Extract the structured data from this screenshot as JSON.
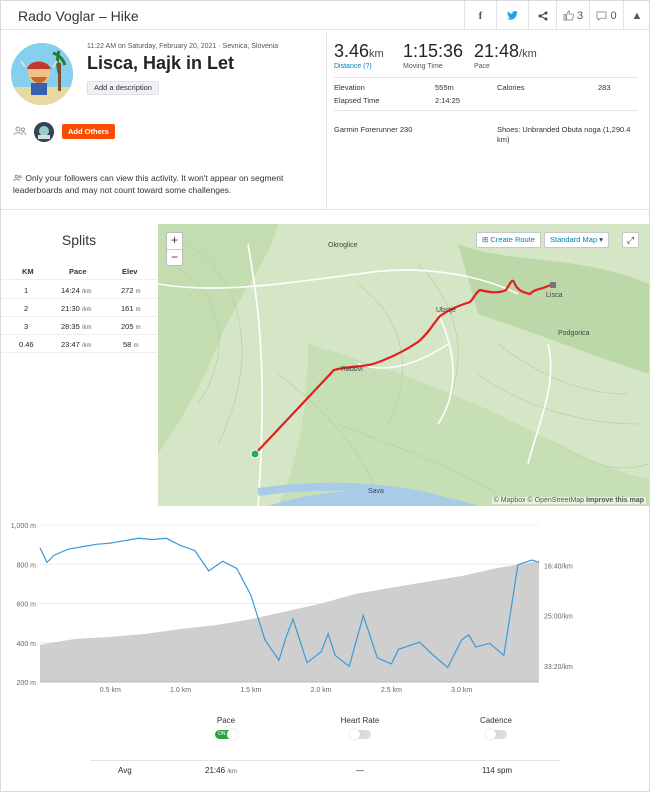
{
  "header": {
    "title": "Rado Voglar – Hike",
    "kudos_count": "3",
    "comment_count": "0"
  },
  "activity": {
    "meta": "11:22 AM on Saturday, February 20, 2021 · Sevnica, Slovenia",
    "name": "Lisca, Hajk in Let",
    "add_description": "Add a description",
    "add_others": "Add Others",
    "privacy": "Only your followers can view this activity. It won't appear on segment leaderboards and may not count toward some challenges."
  },
  "stats": {
    "distance": {
      "value": "3.46",
      "unit": "km",
      "label": "Distance (?)"
    },
    "moving_time": {
      "value": "1:15:36",
      "label": "Moving Time"
    },
    "pace": {
      "value": "21:48",
      "unit": "/km",
      "label": "Pace"
    },
    "elevation_label": "Elevation",
    "elevation_value": "555m",
    "calories_label": "Calories",
    "calories_value": "283",
    "elapsed_label": "Elapsed Time",
    "elapsed_value": "2:14:25",
    "device": "Garmin Forerunner 230",
    "shoes": "Shoes: Unbranded Obuta noga (1,290.4 km)"
  },
  "splits": {
    "title": "Splits",
    "headers": [
      "KM",
      "Pace",
      "Elev"
    ],
    "rows": [
      {
        "km": "1",
        "pace": "14:24",
        "pace_unit": "/km",
        "elev": "272",
        "elev_unit": "m"
      },
      {
        "km": "2",
        "pace": "21:30",
        "pace_unit": "/km",
        "elev": "161",
        "elev_unit": "m"
      },
      {
        "km": "3",
        "pace": "28:35",
        "pace_unit": "/km",
        "elev": "205",
        "elev_unit": "m"
      },
      {
        "km": "0.46",
        "pace": "23:47",
        "pace_unit": "/km",
        "elev": "58",
        "elev_unit": "m"
      }
    ]
  },
  "map": {
    "zoom_in": "+",
    "zoom_out": "−",
    "create_route": "Create Route",
    "standard_map": "Standard Map",
    "attribution": "© Mapbox © OpenStreetMap",
    "improve": "Improve this map",
    "labels": [
      "Okroglice",
      "Lisca",
      "Podgorica",
      "Ubstje",
      "Radovi",
      "Sava"
    ],
    "route_color": "#e02020"
  },
  "chart_data": {
    "type": "line",
    "x_ticks": [
      "0.5 km",
      "1.0 km",
      "1.5 km",
      "2.0 km",
      "2.5 km",
      "3.0 km"
    ],
    "y_left_ticks": [
      "1,000 m",
      "800 m",
      "600 m",
      "400 m",
      "200 m"
    ],
    "y_right_ticks": [
      "16:40/km",
      "25:00/km",
      "33:20/km"
    ],
    "elevation_color": "#cfcfcf",
    "pace_color": "#3a9ad9",
    "series": [
      {
        "name": "Elevation",
        "x": [
          0,
          0.25,
          0.5,
          0.75,
          1.0,
          1.25,
          1.5,
          1.75,
          2.0,
          2.25,
          2.5,
          2.75,
          3.0,
          3.25,
          3.5,
          3.55
        ],
        "y": [
          390,
          420,
          430,
          445,
          470,
          490,
          520,
          560,
          600,
          650,
          680,
          710,
          740,
          780,
          810,
          820
        ]
      },
      {
        "name": "Pace",
        "x": [
          0,
          0.05,
          0.1,
          0.2,
          0.3,
          0.4,
          0.5,
          0.6,
          0.7,
          0.8,
          0.9,
          1.0,
          1.05,
          1.1,
          1.2,
          1.3,
          1.4,
          1.5,
          1.6,
          1.7,
          1.75,
          1.8,
          1.9,
          2.0,
          2.05,
          2.1,
          2.2,
          2.3,
          2.4,
          2.5,
          2.55,
          2.6,
          2.7,
          2.8,
          2.9,
          3.0,
          3.05,
          3.1,
          3.2,
          3.3,
          3.4,
          3.5,
          3.55
        ],
        "y": [
          13.8,
          16.2,
          15.0,
          14.0,
          13.6,
          13.2,
          13.0,
          12.6,
          12.2,
          12.4,
          12.2,
          13.4,
          13.8,
          14.2,
          17.6,
          16.0,
          17.2,
          21.6,
          29.0,
          32.4,
          28.6,
          25.6,
          32.8,
          31.0,
          28.0,
          31.6,
          33.4,
          25.0,
          32.0,
          33.0,
          30.6,
          30.2,
          29.4,
          31.6,
          33.6,
          29.0,
          28.2,
          30.2,
          29.6,
          31.6,
          16.6,
          15.8,
          16.2
        ]
      }
    ]
  },
  "legend": {
    "pace": "Pace",
    "pace_toggle": "ON",
    "heart_rate": "Heart Rate",
    "cadence": "Cadence",
    "avg_label": "Avg",
    "avg_pace": "21:46",
    "avg_pace_unit": "/km",
    "avg_hr": "—",
    "avg_cadence": "114 spm"
  }
}
